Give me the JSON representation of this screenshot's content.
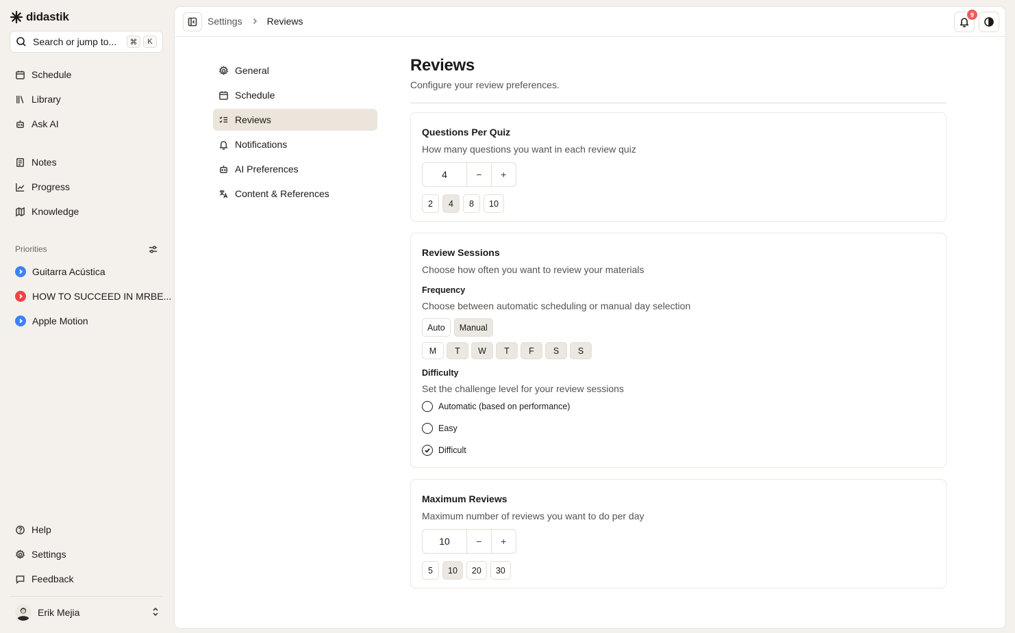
{
  "app": {
    "name": "didastik",
    "search": {
      "label": "Search or jump to...",
      "kbd1": "⌘",
      "kbd2": "K"
    }
  },
  "sidebar": {
    "nav": [
      {
        "label": "Schedule",
        "icon": "calendar-icon"
      },
      {
        "label": "Library",
        "icon": "library-icon"
      },
      {
        "label": "Ask AI",
        "icon": "bot-icon"
      },
      {
        "label": "Notes",
        "icon": "notes-icon"
      },
      {
        "label": "Progress",
        "icon": "chart-icon"
      },
      {
        "label": "Knowledge",
        "icon": "map-icon"
      }
    ],
    "priorities_label": "Priorities",
    "priorities": [
      {
        "label": "Guitarra Acústica",
        "color": "#3b82f6"
      },
      {
        "label": "HOW TO SUCCEED IN MRBE...",
        "color": "#ef4444"
      },
      {
        "label": "Apple Motion",
        "color": "#3b82f6"
      }
    ],
    "bottom": [
      {
        "label": "Help",
        "icon": "help-icon"
      },
      {
        "label": "Settings",
        "icon": "gear-icon"
      },
      {
        "label": "Feedback",
        "icon": "message-icon"
      }
    ],
    "user": {
      "name": "Erik Mejia"
    }
  },
  "topbar": {
    "breadcrumb": [
      "Settings",
      "Reviews"
    ],
    "notifications_count": "9"
  },
  "settings_nav": [
    {
      "label": "General",
      "icon": "gear-icon"
    },
    {
      "label": "Schedule",
      "icon": "calendar-icon"
    },
    {
      "label": "Reviews",
      "icon": "list-check-icon",
      "active": true
    },
    {
      "label": "Notifications",
      "icon": "bell-icon"
    },
    {
      "label": "AI Preferences",
      "icon": "bot-icon"
    },
    {
      "label": "Content & References",
      "icon": "translate-icon"
    }
  ],
  "page": {
    "title": "Reviews",
    "subtitle": "Configure your review preferences."
  },
  "questions_per_quiz": {
    "title": "Questions Per Quiz",
    "description": "How many questions you want in each review quiz",
    "value": "4",
    "minus": "−",
    "plus": "+",
    "presets": [
      "2",
      "4",
      "8",
      "10"
    ]
  },
  "review_sessions": {
    "title": "Review Sessions",
    "description": "Choose how often you want to review your materials",
    "frequency": {
      "title": "Frequency",
      "description": "Choose between automatic scheduling or manual day selection",
      "options": [
        "Auto",
        "Manual"
      ],
      "selected": "Manual",
      "days": [
        "M",
        "T",
        "W",
        "T",
        "F",
        "S",
        "S"
      ]
    },
    "difficulty": {
      "title": "Difficulty",
      "description": "Set the challenge level for your review sessions",
      "options": [
        "Automatic (based on performance)",
        "Easy",
        "Difficult"
      ],
      "selected": "Difficult"
    }
  },
  "maximum_reviews": {
    "title": "Maximum Reviews",
    "description": "Maximum number of reviews you want to do per day",
    "value": "10",
    "minus": "−",
    "plus": "+",
    "presets": [
      "5",
      "10",
      "20",
      "30"
    ]
  }
}
